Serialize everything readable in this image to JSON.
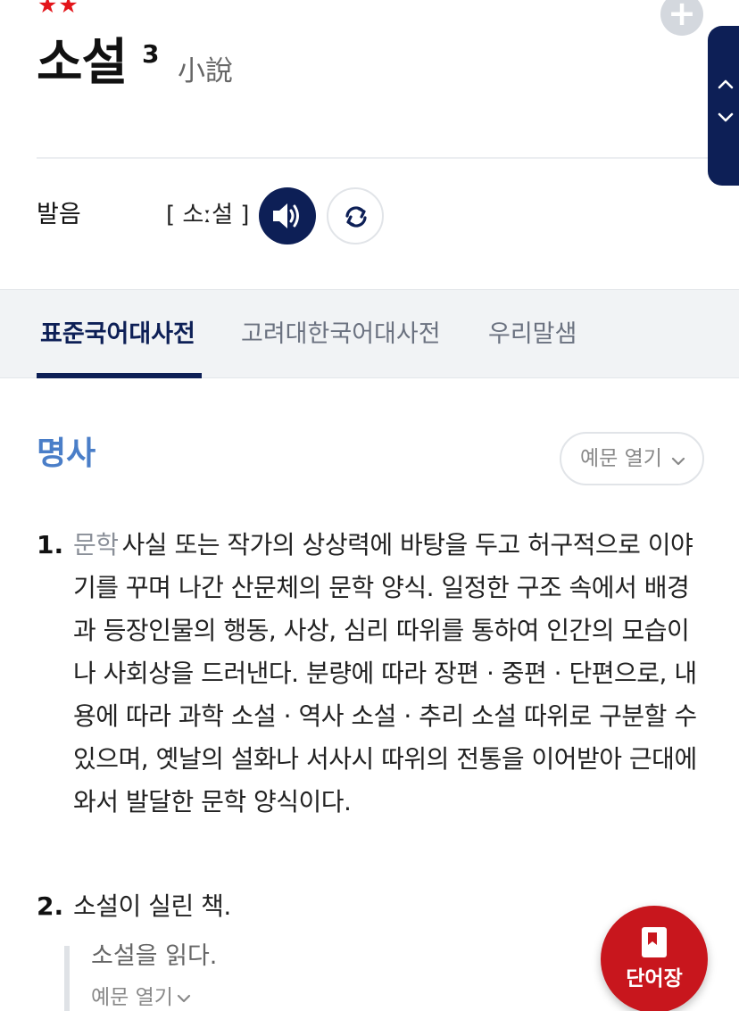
{
  "entry": {
    "stars": "★★",
    "headword": "소설",
    "homonym_number": "3",
    "hanja": "小說"
  },
  "pronunciation": {
    "label": "발음",
    "text": "[ 소ː설 ]"
  },
  "tabs": [
    {
      "label": "표준국어대사전",
      "active": true
    },
    {
      "label": "고려대한국어대사전",
      "active": false
    },
    {
      "label": "우리말샘",
      "active": false
    }
  ],
  "part_of_speech": "명사",
  "example_toggle_label": "예문 열기",
  "definitions": [
    {
      "number": "1.",
      "field": "문학",
      "text": "사실 또는 작가의 상상력에 바탕을 두고 허구적으로 이야기를 꾸며 나간 산문체의 문학 양식. 일정한 구조 속에서 배경과 등장인물의 행동, 사상, 심리 따위를 통하여 인간의 모습이나 사회상을 드러낸다. 분량에 따라 장편 · 중편 · 단편으로, 내용에 따라 과학 소설 · 역사 소설 · 추리 소설 따위로 구분할 수 있으며, 옛날의 설화나 서사시 따위의 전통을 이어받아 근대에 와서 발달한 문학 양식이다."
    },
    {
      "number": "2.",
      "text": "소설이 실린 책.",
      "example": "소설을 읽다.",
      "example_toggle_label": "예문 열기"
    }
  ],
  "fab": {
    "label": "단어장",
    "icon": "bookmark-book-icon"
  },
  "colors": {
    "navy": "#0d1f56",
    "red": "#c8161d",
    "star_red": "#e3151a",
    "pos_blue": "#4a7ec8"
  }
}
